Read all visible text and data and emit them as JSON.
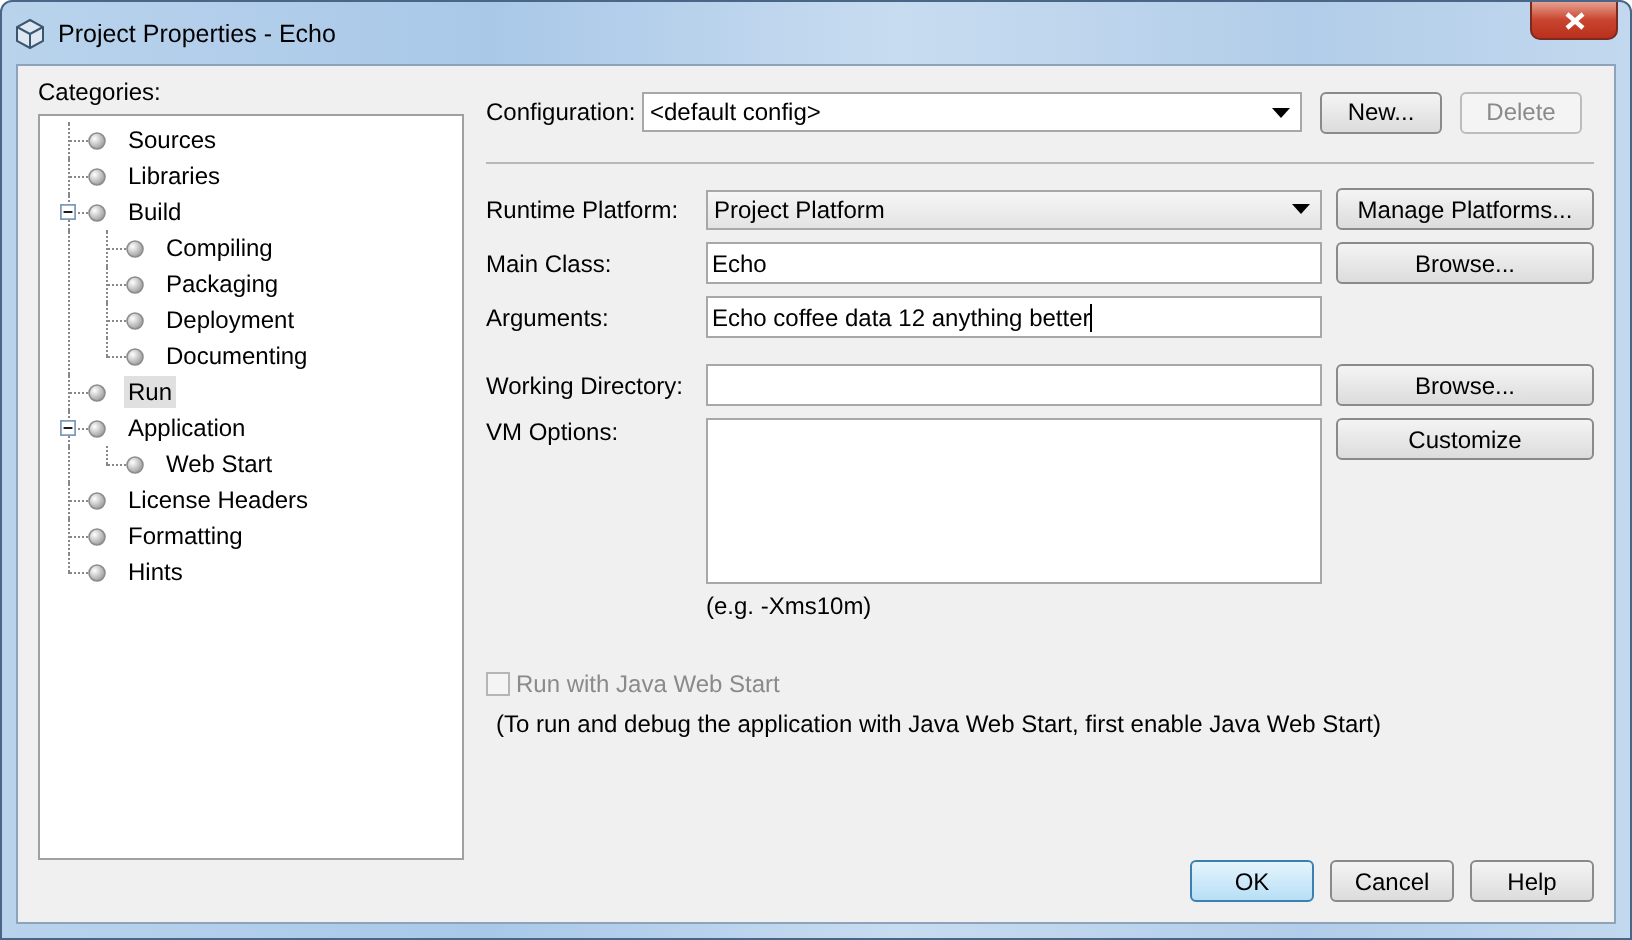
{
  "window": {
    "title": "Project Properties - Echo"
  },
  "categories": {
    "label": "Categories:",
    "items": [
      {
        "label": "Sources",
        "selected": false
      },
      {
        "label": "Libraries",
        "selected": false
      },
      {
        "label": "Build",
        "selected": false,
        "expanded": true,
        "children": [
          {
            "label": "Compiling",
            "selected": false
          },
          {
            "label": "Packaging",
            "selected": false
          },
          {
            "label": "Deployment",
            "selected": false
          },
          {
            "label": "Documenting",
            "selected": false
          }
        ]
      },
      {
        "label": "Run",
        "selected": true
      },
      {
        "label": "Application",
        "selected": false,
        "expanded": true,
        "children": [
          {
            "label": "Web Start",
            "selected": false
          }
        ]
      },
      {
        "label": "License Headers",
        "selected": false
      },
      {
        "label": "Formatting",
        "selected": false
      },
      {
        "label": "Hints",
        "selected": false
      }
    ]
  },
  "configuration": {
    "label": "Configuration:",
    "value": "<default config>",
    "buttons": [
      {
        "label": "New...",
        "disabled": false
      },
      {
        "label": "Delete",
        "disabled": true
      }
    ]
  },
  "run_fields": [
    {
      "kind": "combo",
      "label": "Runtime Platform:",
      "value": "Project Platform",
      "button": "Manage Platforms..."
    },
    {
      "kind": "text",
      "label": "Main Class:",
      "value": "Echo",
      "button": "Browse..."
    },
    {
      "kind": "text",
      "label": "Arguments:",
      "value": "Echo coffee data 12 anything better",
      "focused": true
    }
  ],
  "environment_fields": [
    {
      "kind": "text",
      "label": "Working Directory:",
      "button": "Browse..."
    },
    {
      "kind": "textarea",
      "label": "VM Options:",
      "button": "Customize",
      "hint": "(e.g. -Xms10m)"
    }
  ],
  "web_start": {
    "label": "Run with Java Web Start",
    "checked": false,
    "disabled": true,
    "note": "(To run and debug the application with Java Web Start, first enable Java Web Start)"
  },
  "buttons": [
    {
      "label": "OK",
      "default": true
    },
    {
      "label": "Cancel",
      "default": false
    },
    {
      "label": "Help",
      "default": false
    }
  ]
}
